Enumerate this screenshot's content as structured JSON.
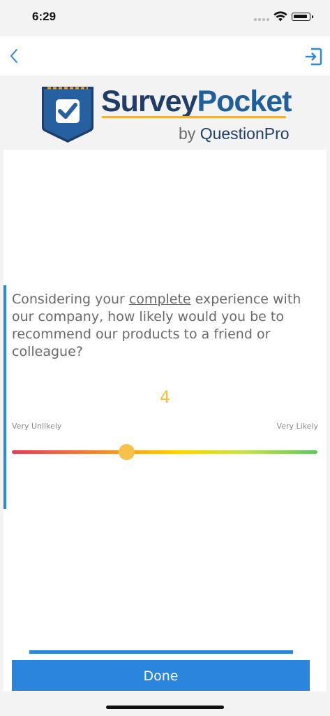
{
  "status_bar": {
    "time": "6:29"
  },
  "navbar": {
    "back_icon": "chevron-left-icon",
    "exit_icon": "exit-icon",
    "accent_color": "#2a86dc"
  },
  "logo": {
    "part1": "Survey",
    "part2": "Pocket",
    "by_prefix": "by ",
    "by_brand": "QuestionPro"
  },
  "question": {
    "text_before": "Considering your ",
    "text_underlined": "complete",
    "text_after": " experience with our company, how likely would you be to recommend our products to a friend or colleague?"
  },
  "slider": {
    "value": "4",
    "min_label": "Very Unlikely",
    "max_label": "Very Likely",
    "position_fraction": 0.375,
    "thumb_color": "#f7c04a"
  },
  "progress": {
    "fraction": 1.0,
    "color": "#2a86dc"
  },
  "footer": {
    "done_label": "Done"
  }
}
